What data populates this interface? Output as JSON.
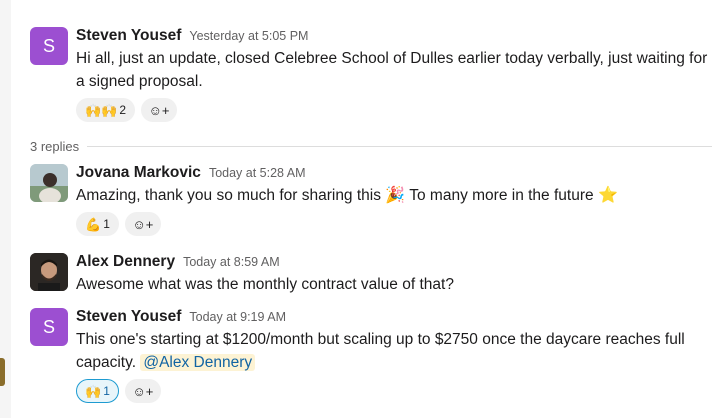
{
  "messages": [
    {
      "author": "Steven Yousef",
      "time": "Yesterday at 5:05 PM",
      "avatar_letter": "S",
      "text": "Hi all, just an update, closed Celebree School of Dulles earlier today verbally, just waiting for a signed proposal.",
      "reactions": [
        {
          "emoji": "🙌🙌",
          "count": "2"
        }
      ]
    },
    {
      "author": "Jovana Markovic",
      "time": "Today at 5:28 AM",
      "text_part1": "Amazing, thank you so much for sharing this",
      "emoji1": "🎉",
      "text_part2": "To many more in the future",
      "emoji2": "⭐",
      "reactions": [
        {
          "emoji": "💪",
          "count": "1"
        }
      ]
    },
    {
      "author": "Alex Dennery",
      "time": "Today at 8:59 AM",
      "text": "Awesome what was the monthly contract value of that?"
    },
    {
      "author": "Steven Yousef",
      "time": "Today at 9:19 AM",
      "avatar_letter": "S",
      "text": "This one's starting at $1200/month but scaling up to $2750 once the daycare reaches full capacity.",
      "mention": "@Alex Dennery",
      "reactions": [
        {
          "emoji": "🙌",
          "count": "1"
        }
      ]
    }
  ],
  "thread": {
    "replies_label": "3 replies"
  },
  "add_reaction_icon": "☺+"
}
